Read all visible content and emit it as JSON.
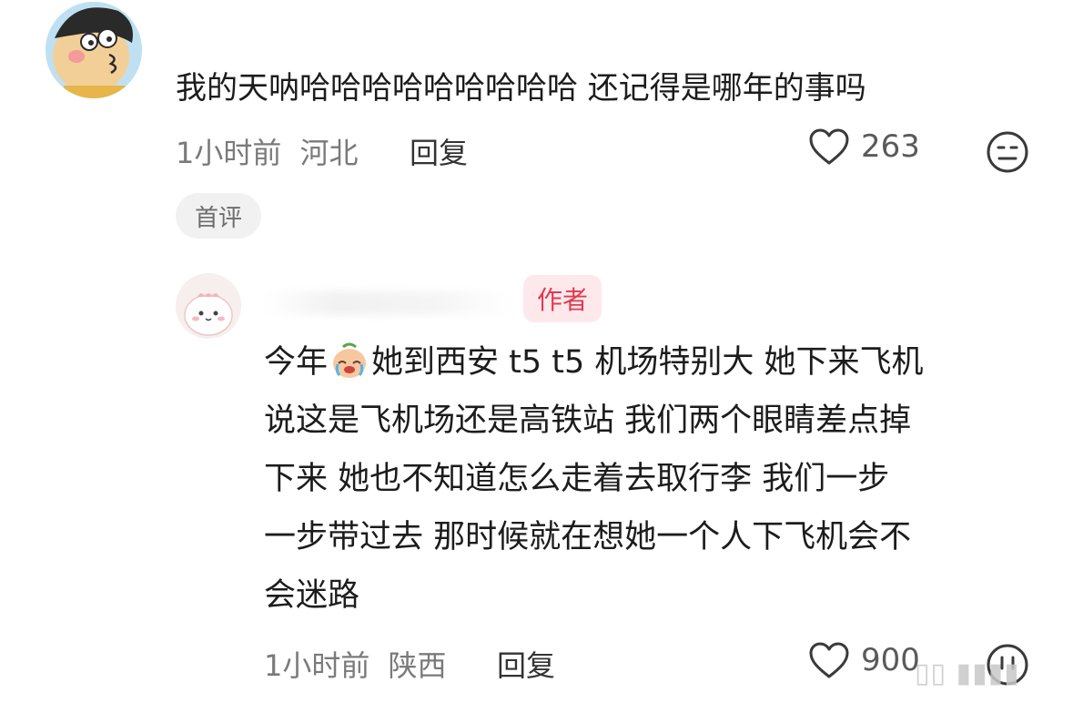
{
  "comment": {
    "text": "我的天呐哈哈哈哈哈哈哈哈哈 还记得是哪年的事吗",
    "time": "1小时前",
    "location": "河北",
    "reply_label": "回复",
    "likes": "263",
    "badge": "首评"
  },
  "reply": {
    "author_tag": "作者",
    "lines": [
      {
        "before": "今年",
        "after": "她到西安 t5 t5 机场特别大 她下来飞机"
      },
      {
        "text": "说这是飞机场还是高铁站 我们两个眼睛差点掉"
      },
      {
        "text": "下来 她也不知道怎么走着去取行李 我们一步"
      },
      {
        "text": "一步带过去 那时候就在想她一个人下飞机会不"
      },
      {
        "text": "会迷路"
      }
    ],
    "time": "1小时前",
    "location": "陕西",
    "reply_label": "回复",
    "likes": "900"
  },
  "icons": {
    "like": "heart-outline-icon",
    "dislike": "meh-face-icon",
    "emoji": "crying-emoji-icon"
  },
  "colors": {
    "author_tag_text": "#e03a4f",
    "author_tag_bg": "#fde9ec",
    "meta_text": "#7a7a7a"
  }
}
